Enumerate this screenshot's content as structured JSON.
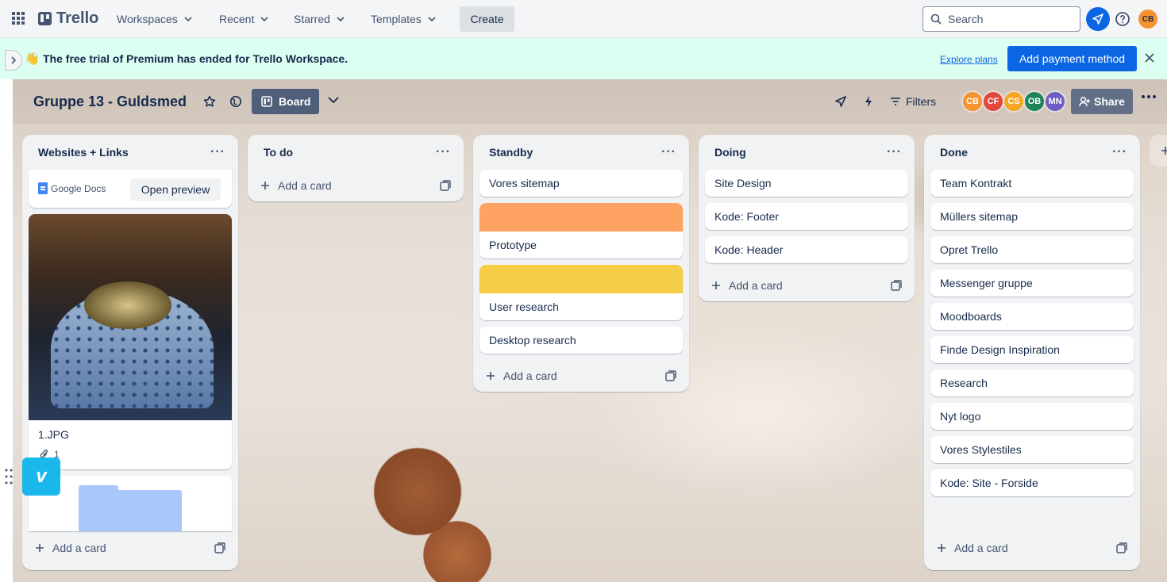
{
  "topbar": {
    "app_name": "Trello",
    "nav": [
      "Workspaces",
      "Recent",
      "Starred",
      "Templates"
    ],
    "create_label": "Create",
    "search_placeholder": "Search",
    "avatar_initials": "CB"
  },
  "banner": {
    "emoji": "👋",
    "text": "The free trial of Premium has ended for Trello Workspace.",
    "explore_label": "Explore plans",
    "pay_label": "Add payment method"
  },
  "board": {
    "title": "Gruppe 13 - Guldsmed",
    "view_label": "Board",
    "filters_label": "Filters",
    "share_label": "Share",
    "members": [
      {
        "initials": "CB",
        "color": "#f79233"
      },
      {
        "initials": "CF",
        "color": "#e2483d"
      },
      {
        "initials": "CS",
        "color": "#f5a623"
      },
      {
        "initials": "OB",
        "color": "#1f845a"
      },
      {
        "initials": "MN",
        "color": "#6e5dc6"
      }
    ]
  },
  "lists": [
    {
      "title": "Websites + Links",
      "link_card": {
        "source": "Google Docs",
        "button": "Open preview"
      },
      "image_card": {
        "title": "1.JPG",
        "attachments": "1"
      },
      "add_label": "Add a card"
    },
    {
      "title": "To do",
      "cards": [],
      "add_label": "Add a card"
    },
    {
      "title": "Standby",
      "cards": [
        {
          "title": "Vores sitemap",
          "cover": ""
        },
        {
          "title": "Prototype",
          "cover": "#fea362"
        },
        {
          "title": "User research",
          "cover": "#f5cd47"
        },
        {
          "title": "Desktop research",
          "cover": ""
        }
      ],
      "add_label": "Add a card"
    },
    {
      "title": "Doing",
      "cards": [
        {
          "title": "Site Design"
        },
        {
          "title": "Kode: Footer"
        },
        {
          "title": "Kode: Header"
        }
      ],
      "add_label": "Add a card"
    },
    {
      "title": "Done",
      "cards": [
        {
          "title": "Team Kontrakt"
        },
        {
          "title": "Müllers sitemap"
        },
        {
          "title": "Opret Trello"
        },
        {
          "title": "Messenger gruppe"
        },
        {
          "title": "Moodboards"
        },
        {
          "title": "Finde Design Inspiration"
        },
        {
          "title": "Research"
        },
        {
          "title": "Nyt logo"
        },
        {
          "title": "Vores Stylestiles"
        },
        {
          "title": "Kode: Site - Forside"
        }
      ],
      "add_label": "Add a card"
    }
  ]
}
